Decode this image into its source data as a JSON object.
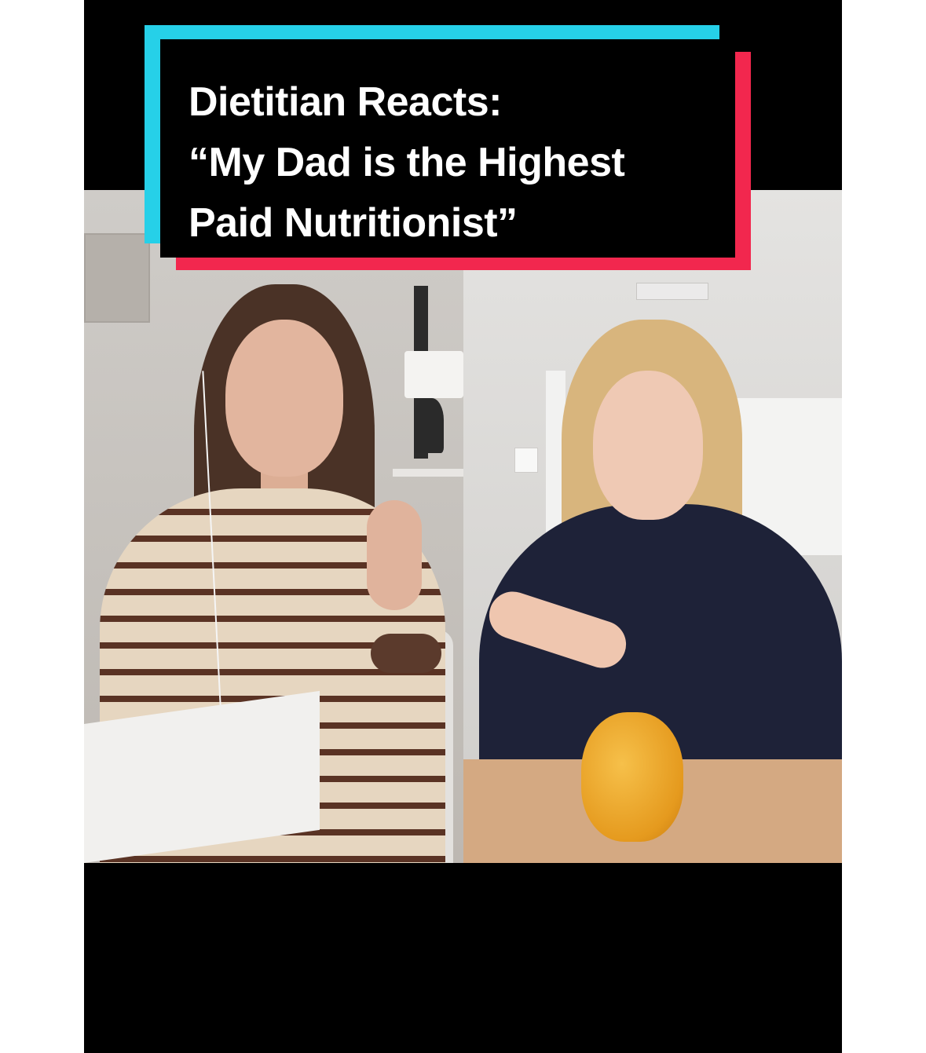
{
  "overlay": {
    "title_lines": [
      "Dietitian Reacts:",
      "“My Dad is the Highest",
      "Paid Nutritionist”"
    ]
  },
  "colors": {
    "background": "#ffffff",
    "frame": "#000000",
    "title_bg": "#000000",
    "title_text": "#ffffff",
    "accent_cyan": "#26d0e8",
    "accent_red": "#f2274e"
  }
}
